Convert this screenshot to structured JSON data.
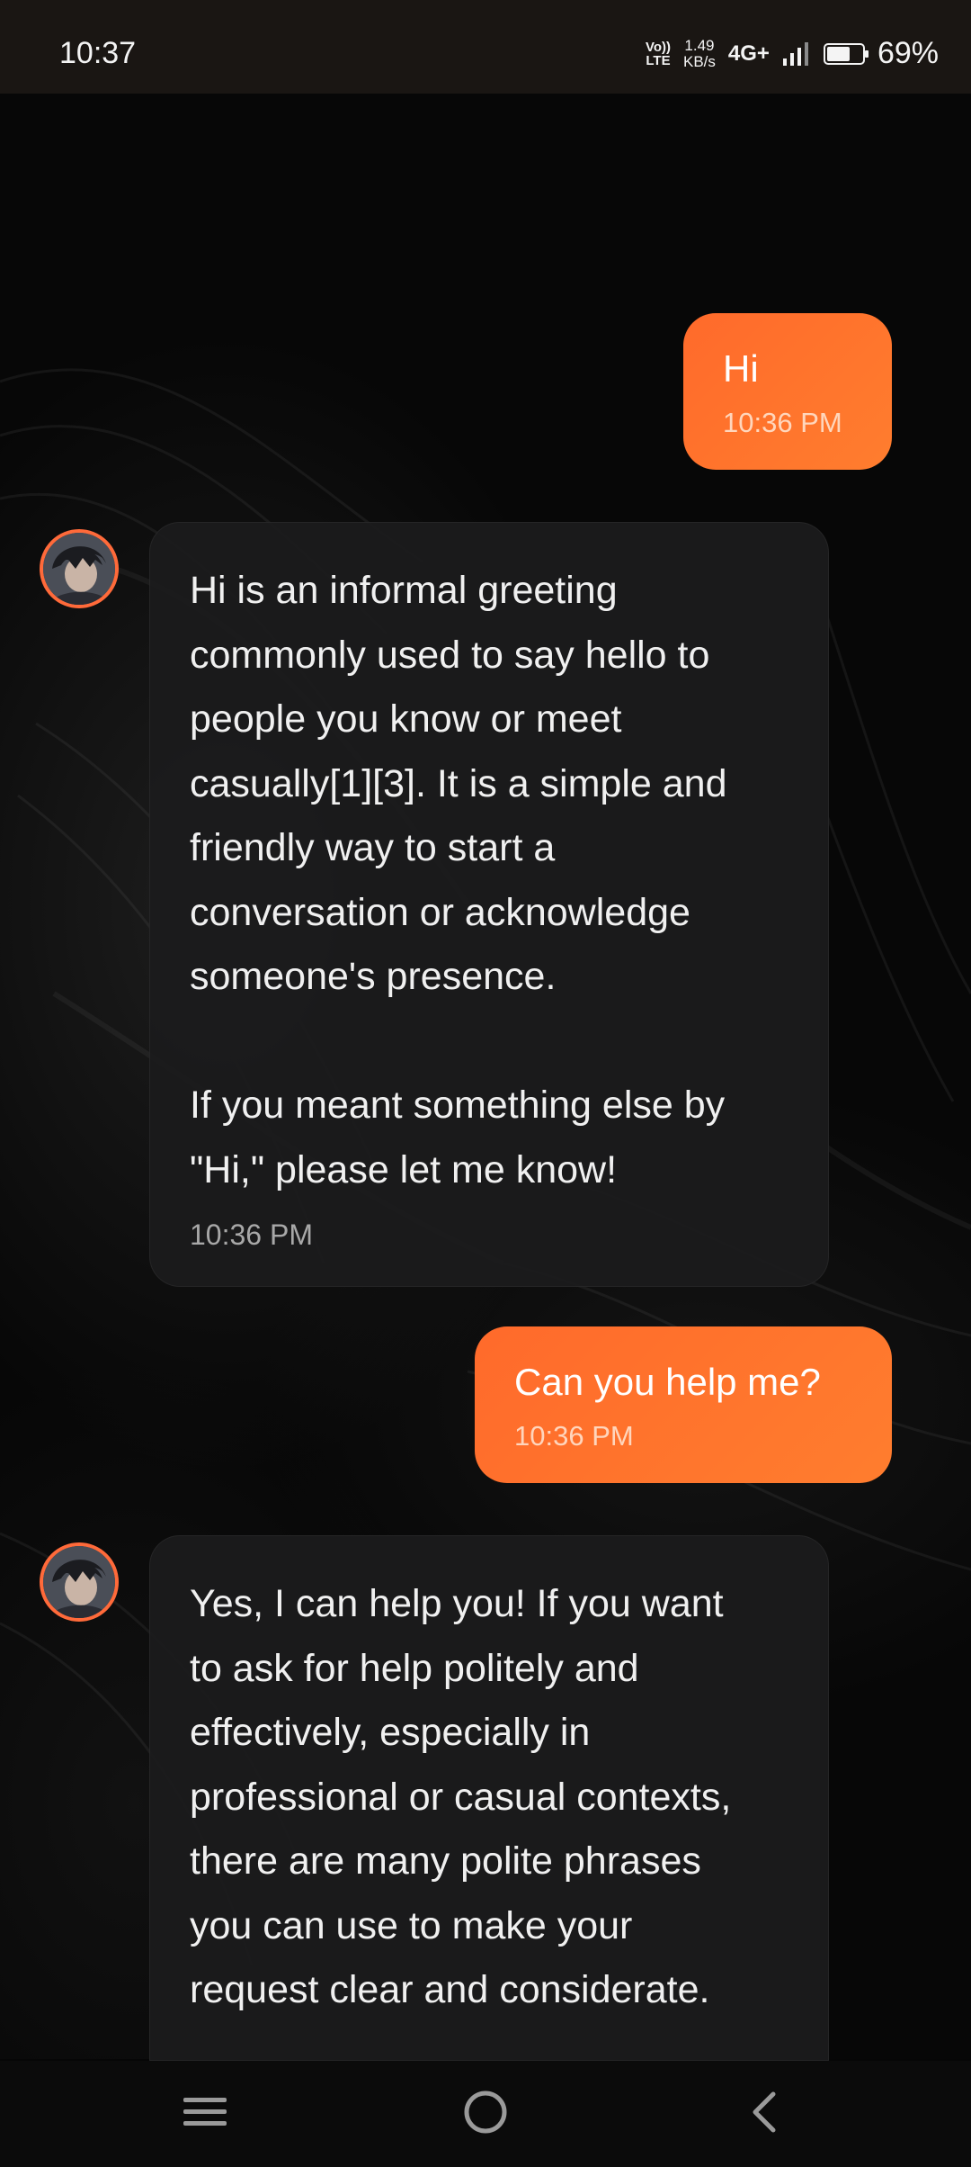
{
  "status_bar": {
    "time": "10:37",
    "volte_top": "Vo))",
    "volte_bottom": "LTE",
    "net_speed_value": "1.49",
    "net_speed_unit": "KB/s",
    "network_type": "4G+",
    "battery_percent": "69%",
    "battery_level": 0.69
  },
  "messages": [
    {
      "role": "user",
      "text": "Hi",
      "time": "10:36 PM"
    },
    {
      "role": "assistant",
      "avatar": "character-avatar",
      "text": "Hi is an informal greeting\ncommonly used to say hello to\npeople you know or meet\ncasually[1][3]. It is a simple and\nfriendly way to start a\nconversation or acknowledge\nsomeone's presence.\n\nIf you meant something else by\n\"Hi,\" please let me know!",
      "time": "10:36 PM"
    },
    {
      "role": "user",
      "text": "Can you help me?",
      "time": "10:36 PM"
    },
    {
      "role": "assistant",
      "avatar": "character-avatar",
      "text": "Yes, I can help you! If you want\nto ask for help politely and\neffectively, especially in\nprofessional or casual contexts,\nthere are many polite phrases\nyou can use to make your\nrequest clear and considerate."
    }
  ],
  "nav_bar": {
    "menu_icon": "menu-icon",
    "home_icon": "home-circle-icon",
    "back_icon": "back-chevron-icon"
  },
  "colors": {
    "accent": "#ff6b2c",
    "bot_bubble": "#1b1b1c",
    "background": "#060606"
  }
}
